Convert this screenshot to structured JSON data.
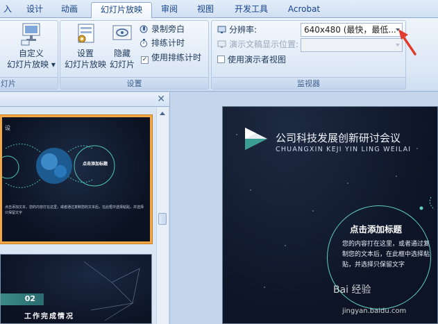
{
  "tabs": [
    {
      "label": "入",
      "active": false
    },
    {
      "label": "设计",
      "active": false
    },
    {
      "label": "动画",
      "active": false
    },
    {
      "label": "幻灯片放映",
      "active": true
    },
    {
      "label": "审阅",
      "active": false
    },
    {
      "label": "视图",
      "active": false
    },
    {
      "label": "开发工具",
      "active": false
    },
    {
      "label": "Acrobat",
      "active": false
    }
  ],
  "ribbon": {
    "group_start": {
      "label": "灯片",
      "custom_show_line1": "自定义",
      "custom_show_line2": "幻灯片放映 ▾"
    },
    "group_setup": {
      "label": "设置",
      "setup_show_line1": "设置",
      "setup_show_line2": "幻灯片放映",
      "hide_slide_line1": "隐藏",
      "hide_slide_line2": "幻灯片",
      "record_narration": "录制旁白",
      "rehearse_timings": "排练计时",
      "use_rehearsed_timings": "使用排练计时",
      "use_rehearsed_timings_checked": true
    },
    "group_monitors": {
      "label": "监视器",
      "resolution_label": "分辨率:",
      "resolution_value": "640x480 (最快，最低...",
      "show_on_label": "演示文稿显示位置:",
      "show_on_value": "",
      "presenter_view": "使用演示者视图",
      "presenter_view_checked": false
    }
  },
  "thumbnails": {
    "slide1": {
      "corner_text": "设",
      "node_title": "点击添加标题",
      "caption": "点击添加文本，您的内容打在这里，或者通过复制您的文本后，在此框中选择粘贴，并选择只保留文字"
    },
    "slide2": {
      "number": "02",
      "title": "工作完成情况"
    }
  },
  "slide": {
    "title": "公司科技发展创新研讨会议",
    "subtitle": "CHUANGXIN KEJI YIN LING WEILAI",
    "box_title": "点击添加标题",
    "box_body": "您的内容打在这里，或者通过复制您的文本后，在此框中选择粘贴，并选择只保留文字"
  },
  "watermark": {
    "text": "Bai 经验",
    "url": "jingyan.baidu.com"
  },
  "colors": {
    "accent_orange": "#f3a847",
    "slide_teal": "#5fd1c3",
    "annotation_red": "#e23a2c"
  }
}
